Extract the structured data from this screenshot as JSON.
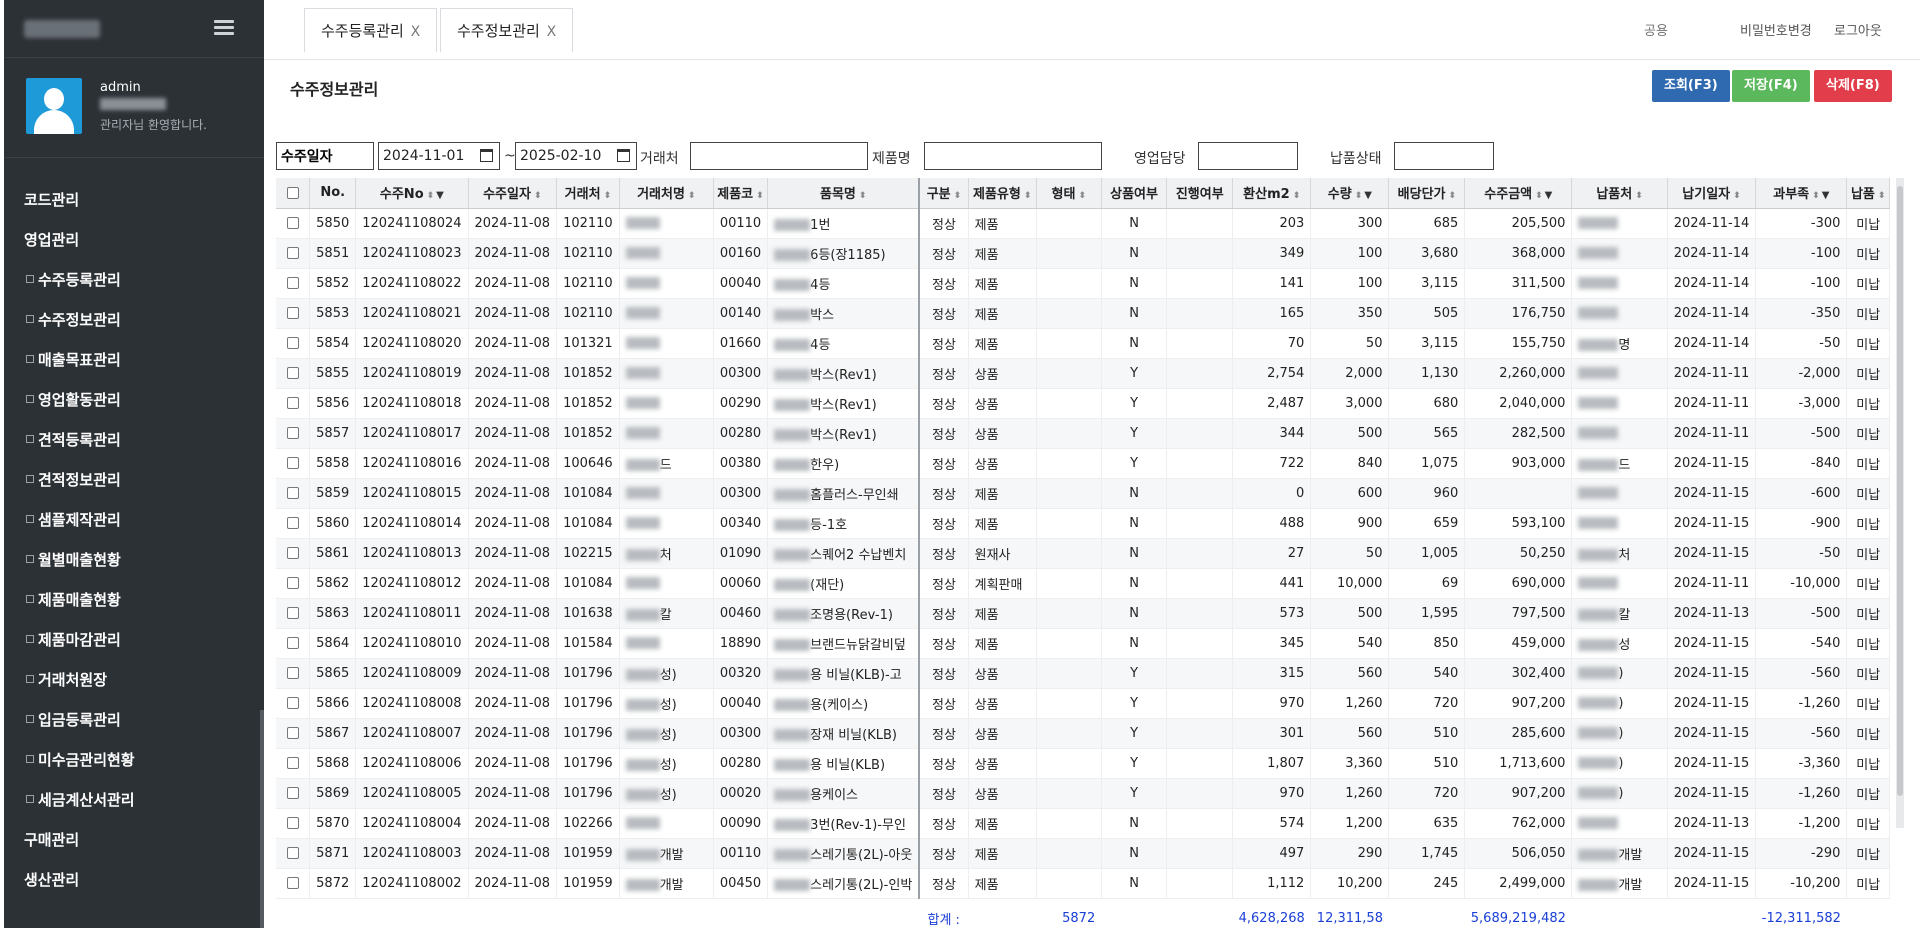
{
  "sidebar": {
    "user": {
      "name": "admin",
      "welcome": "관리자님 환영합니다."
    },
    "menu": [
      "코드관리",
      "영업관리",
      "수주등록관리",
      "수주정보관리",
      "매출목표관리",
      "영업활동관리",
      "견적등록관리",
      "견적정보관리",
      "샘플제작관리",
      "월별매출현황",
      "제품매출현황",
      "제품마감관리",
      "거래처원장",
      "입금등록관리",
      "미수금관리현황",
      "세금계산서관리",
      "구매관리",
      "생산관리"
    ]
  },
  "topbar": {
    "tabs": [
      "수주등록관리",
      "수주정보관리"
    ],
    "tab_close": "X",
    "role_placeholder": "공용",
    "change_password": "비밀번호변경",
    "logout": "로그아웃"
  },
  "page": {
    "title": "수주정보관리",
    "buttons": {
      "query": "조회(F3)",
      "save": "저장(F4)",
      "delete": "삭제(F8)"
    }
  },
  "filters": {
    "date_type": "수주일자",
    "date_from": "2024-11-01",
    "tilde": "~",
    "date_to": "2025-02-10",
    "customer_label": "거래처",
    "product_label": "제품명",
    "sales_rep_label": "영업담당",
    "delivery_status_label": "납품상태"
  },
  "grid": {
    "columns": [
      "No.",
      "수주No",
      "수주일자",
      "거래처",
      "거래처명",
      "제품코",
      "품목명",
      "구분",
      "제품유형",
      "형태",
      "상품여부",
      "진행여부",
      "환산m2",
      "수량",
      "배당단가",
      "수주금액",
      "납품처",
      "납기일자",
      "과부족",
      "납품"
    ],
    "rows": [
      {
        "no": "5850",
        "order_no": "120241108024",
        "date": "2024-11-08",
        "cust": "102110",
        "cust_name": "",
        "code": "00110",
        "item": "1번",
        "gubun": "정상",
        "ptype": "제품",
        "form": "",
        "goods": "N",
        "prog": "",
        "m2": "203",
        "qty": "300",
        "price": "685",
        "amount": "205,500",
        "dest": "",
        "due": "2024-11-14",
        "diff": "-300",
        "status": "미납"
      },
      {
        "no": "5851",
        "order_no": "120241108023",
        "date": "2024-11-08",
        "cust": "102110",
        "cust_name": "",
        "code": "00160",
        "item": "6등(장1185)",
        "gubun": "정상",
        "ptype": "제품",
        "form": "",
        "goods": "N",
        "prog": "",
        "m2": "349",
        "qty": "100",
        "price": "3,680",
        "amount": "368,000",
        "dest": "",
        "due": "2024-11-14",
        "diff": "-100",
        "status": "미납"
      },
      {
        "no": "5852",
        "order_no": "120241108022",
        "date": "2024-11-08",
        "cust": "102110",
        "cust_name": "",
        "code": "00040",
        "item": "4등",
        "gubun": "정상",
        "ptype": "제품",
        "form": "",
        "goods": "N",
        "prog": "",
        "m2": "141",
        "qty": "100",
        "price": "3,115",
        "amount": "311,500",
        "dest": "",
        "due": "2024-11-14",
        "diff": "-100",
        "status": "미납"
      },
      {
        "no": "5853",
        "order_no": "120241108021",
        "date": "2024-11-08",
        "cust": "102110",
        "cust_name": "",
        "code": "00140",
        "item": "박스",
        "gubun": "정상",
        "ptype": "제품",
        "form": "",
        "goods": "N",
        "prog": "",
        "m2": "165",
        "qty": "350",
        "price": "505",
        "amount": "176,750",
        "dest": "",
        "due": "2024-11-14",
        "diff": "-350",
        "status": "미납"
      },
      {
        "no": "5854",
        "order_no": "120241108020",
        "date": "2024-11-08",
        "cust": "101321",
        "cust_name": "",
        "code": "01660",
        "item": "4등",
        "gubun": "정상",
        "ptype": "제품",
        "form": "",
        "goods": "N",
        "prog": "",
        "m2": "70",
        "qty": "50",
        "price": "3,115",
        "amount": "155,750",
        "dest": "명",
        "due": "2024-11-14",
        "diff": "-50",
        "status": "미납"
      },
      {
        "no": "5855",
        "order_no": "120241108019",
        "date": "2024-11-08",
        "cust": "101852",
        "cust_name": "",
        "code": "00300",
        "item": "박스(Rev1)",
        "gubun": "정상",
        "ptype": "상품",
        "form": "",
        "goods": "Y",
        "prog": "",
        "m2": "2,754",
        "qty": "2,000",
        "price": "1,130",
        "amount": "2,260,000",
        "dest": "",
        "due": "2024-11-11",
        "diff": "-2,000",
        "status": "미납"
      },
      {
        "no": "5856",
        "order_no": "120241108018",
        "date": "2024-11-08",
        "cust": "101852",
        "cust_name": "",
        "code": "00290",
        "item": "박스(Rev1)",
        "gubun": "정상",
        "ptype": "상품",
        "form": "",
        "goods": "Y",
        "prog": "",
        "m2": "2,487",
        "qty": "3,000",
        "price": "680",
        "amount": "2,040,000",
        "dest": "",
        "due": "2024-11-11",
        "diff": "-3,000",
        "status": "미납"
      },
      {
        "no": "5857",
        "order_no": "120241108017",
        "date": "2024-11-08",
        "cust": "101852",
        "cust_name": "",
        "code": "00280",
        "item": "박스(Rev1)",
        "gubun": "정상",
        "ptype": "상품",
        "form": "",
        "goods": "Y",
        "prog": "",
        "m2": "344",
        "qty": "500",
        "price": "565",
        "amount": "282,500",
        "dest": "",
        "due": "2024-11-11",
        "diff": "-500",
        "status": "미납"
      },
      {
        "no": "5858",
        "order_no": "120241108016",
        "date": "2024-11-08",
        "cust": "100646",
        "cust_name": "드",
        "code": "00380",
        "item": "한우)",
        "gubun": "정상",
        "ptype": "상품",
        "form": "",
        "goods": "Y",
        "prog": "",
        "m2": "722",
        "qty": "840",
        "price": "1,075",
        "amount": "903,000",
        "dest": "드",
        "due": "2024-11-15",
        "diff": "-840",
        "status": "미납"
      },
      {
        "no": "5859",
        "order_no": "120241108015",
        "date": "2024-11-08",
        "cust": "101084",
        "cust_name": "",
        "code": "00300",
        "item": "홈플러스-무인쇄",
        "gubun": "정상",
        "ptype": "제품",
        "form": "",
        "goods": "N",
        "prog": "",
        "m2": "0",
        "qty": "600",
        "price": "960",
        "amount": "",
        "dest": "",
        "due": "2024-11-15",
        "diff": "-600",
        "status": "미납"
      },
      {
        "no": "5860",
        "order_no": "120241108014",
        "date": "2024-11-08",
        "cust": "101084",
        "cust_name": "",
        "code": "00340",
        "item": "등-1호",
        "gubun": "정상",
        "ptype": "제품",
        "form": "",
        "goods": "N",
        "prog": "",
        "m2": "488",
        "qty": "900",
        "price": "659",
        "amount": "593,100",
        "dest": "",
        "due": "2024-11-15",
        "diff": "-900",
        "status": "미납"
      },
      {
        "no": "5861",
        "order_no": "120241108013",
        "date": "2024-11-08",
        "cust": "102215",
        "cust_name": "처",
        "code": "01090",
        "item": "스퀘어2 수납벤치",
        "gubun": "정상",
        "ptype": "원재사",
        "form": "",
        "goods": "N",
        "prog": "",
        "m2": "27",
        "qty": "50",
        "price": "1,005",
        "amount": "50,250",
        "dest": "처",
        "due": "2024-11-15",
        "diff": "-50",
        "status": "미납"
      },
      {
        "no": "5862",
        "order_no": "120241108012",
        "date": "2024-11-08",
        "cust": "101084",
        "cust_name": "",
        "code": "00060",
        "item": "(재단)",
        "gubun": "정상",
        "ptype": "계획판매",
        "form": "",
        "goods": "N",
        "prog": "",
        "m2": "441",
        "qty": "10,000",
        "price": "69",
        "amount": "690,000",
        "dest": "",
        "due": "2024-11-11",
        "diff": "-10,000",
        "status": "미납"
      },
      {
        "no": "5863",
        "order_no": "120241108011",
        "date": "2024-11-08",
        "cust": "101638",
        "cust_name": "칼",
        "code": "00460",
        "item": "조명용(Rev-1)",
        "gubun": "정상",
        "ptype": "제품",
        "form": "",
        "goods": "N",
        "prog": "",
        "m2": "573",
        "qty": "500",
        "price": "1,595",
        "amount": "797,500",
        "dest": "칼",
        "due": "2024-11-13",
        "diff": "-500",
        "status": "미납"
      },
      {
        "no": "5864",
        "order_no": "120241108010",
        "date": "2024-11-08",
        "cust": "101584",
        "cust_name": "",
        "code": "18890",
        "item": "브랜드뉴닭갈비덮",
        "gubun": "정상",
        "ptype": "제품",
        "form": "",
        "goods": "N",
        "prog": "",
        "m2": "345",
        "qty": "540",
        "price": "850",
        "amount": "459,000",
        "dest": "성",
        "due": "2024-11-15",
        "diff": "-540",
        "status": "미납"
      },
      {
        "no": "5865",
        "order_no": "120241108009",
        "date": "2024-11-08",
        "cust": "101796",
        "cust_name": "성)",
        "code": "00320",
        "item": "용 비닐(KLB)-고",
        "gubun": "정상",
        "ptype": "상품",
        "form": "",
        "goods": "Y",
        "prog": "",
        "m2": "315",
        "qty": "560",
        "price": "540",
        "amount": "302,400",
        "dest": ")",
        "due": "2024-11-15",
        "diff": "-560",
        "status": "미납"
      },
      {
        "no": "5866",
        "order_no": "120241108008",
        "date": "2024-11-08",
        "cust": "101796",
        "cust_name": "성)",
        "code": "00040",
        "item": "용(케이스)",
        "gubun": "정상",
        "ptype": "상품",
        "form": "",
        "goods": "Y",
        "prog": "",
        "m2": "970",
        "qty": "1,260",
        "price": "720",
        "amount": "907,200",
        "dest": ")",
        "due": "2024-11-15",
        "diff": "-1,260",
        "status": "미납"
      },
      {
        "no": "5867",
        "order_no": "120241108007",
        "date": "2024-11-08",
        "cust": "101796",
        "cust_name": "성)",
        "code": "00300",
        "item": "장재 비닐(KLB)",
        "gubun": "정상",
        "ptype": "상품",
        "form": "",
        "goods": "Y",
        "prog": "",
        "m2": "301",
        "qty": "560",
        "price": "510",
        "amount": "285,600",
        "dest": ")",
        "due": "2024-11-15",
        "diff": "-560",
        "status": "미납"
      },
      {
        "no": "5868",
        "order_no": "120241108006",
        "date": "2024-11-08",
        "cust": "101796",
        "cust_name": "성)",
        "code": "00280",
        "item": "용 비닐(KLB)",
        "gubun": "정상",
        "ptype": "상품",
        "form": "",
        "goods": "Y",
        "prog": "",
        "m2": "1,807",
        "qty": "3,360",
        "price": "510",
        "amount": "1,713,600",
        "dest": ")",
        "due": "2024-11-15",
        "diff": "-3,360",
        "status": "미납"
      },
      {
        "no": "5869",
        "order_no": "120241108005",
        "date": "2024-11-08",
        "cust": "101796",
        "cust_name": "성)",
        "code": "00020",
        "item": "용케이스",
        "gubun": "정상",
        "ptype": "상품",
        "form": "",
        "goods": "Y",
        "prog": "",
        "m2": "970",
        "qty": "1,260",
        "price": "720",
        "amount": "907,200",
        "dest": ")",
        "due": "2024-11-15",
        "diff": "-1,260",
        "status": "미납"
      },
      {
        "no": "5870",
        "order_no": "120241108004",
        "date": "2024-11-08",
        "cust": "102266",
        "cust_name": "",
        "code": "00090",
        "item": "3번(Rev-1)-무인",
        "gubun": "정상",
        "ptype": "제품",
        "form": "",
        "goods": "N",
        "prog": "",
        "m2": "574",
        "qty": "1,200",
        "price": "635",
        "amount": "762,000",
        "dest": "",
        "due": "2024-11-13",
        "diff": "-1,200",
        "status": "미납"
      },
      {
        "no": "5871",
        "order_no": "120241108003",
        "date": "2024-11-08",
        "cust": "101959",
        "cust_name": "개발",
        "code": "00110",
        "item": "스레기통(2L)-아웃",
        "gubun": "정상",
        "ptype": "제품",
        "form": "",
        "goods": "N",
        "prog": "",
        "m2": "497",
        "qty": "290",
        "price": "1,745",
        "amount": "506,050",
        "dest": "개발",
        "due": "2024-11-15",
        "diff": "-290",
        "status": "미납"
      },
      {
        "no": "5872",
        "order_no": "120241108002",
        "date": "2024-11-08",
        "cust": "101959",
        "cust_name": "개발",
        "code": "00450",
        "item": "스레기통(2L)-인박",
        "gubun": "정상",
        "ptype": "제품",
        "form": "",
        "goods": "N",
        "prog": "",
        "m2": "1,112",
        "qty": "10,200",
        "price": "245",
        "amount": "2,499,000",
        "dest": "개발",
        "due": "2024-11-15",
        "diff": "-10,200",
        "status": "미납"
      }
    ],
    "footer": {
      "label": "합계 :",
      "count": "5872",
      "m2": "4,628,268",
      "qty": "12,311,58",
      "amount": "5,689,219,482",
      "diff": "-12,311,582"
    }
  },
  "colors": {
    "sidebar_bg": "#2c3136",
    "query": "#2f6ab1",
    "save": "#5cb85c",
    "delete": "#e23d4a",
    "total_text": "#1a3fd6"
  }
}
